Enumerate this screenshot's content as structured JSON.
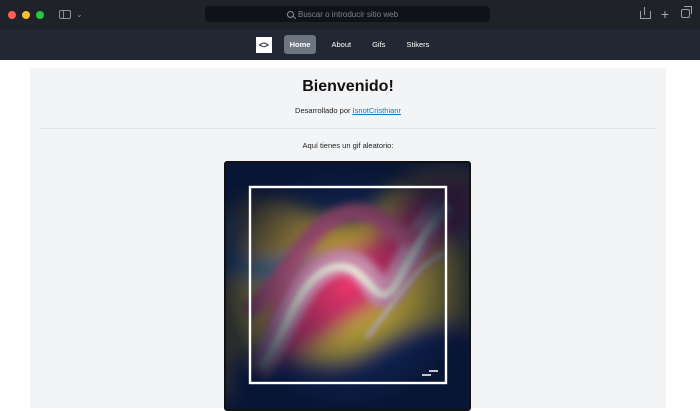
{
  "browser": {
    "address_placeholder": "Buscar o introducir sitio web"
  },
  "nav": {
    "logo_text": "<>",
    "items": [
      {
        "label": "Home",
        "active": true
      },
      {
        "label": "About",
        "active": false
      },
      {
        "label": "Gifs",
        "active": false
      },
      {
        "label": "Stikers",
        "active": false
      }
    ]
  },
  "main": {
    "title": "Bienvenido!",
    "byline_prefix": "Desarrollado por",
    "author_link": "IsnotCristhianr",
    "gif_caption": "Aquí tienes un gif aleatorio:"
  },
  "colors": {
    "nav_bg": "#212834",
    "chrome_bg": "#1f2329",
    "content_bg": "#f3f4f6",
    "link": "#0c7bbf"
  }
}
